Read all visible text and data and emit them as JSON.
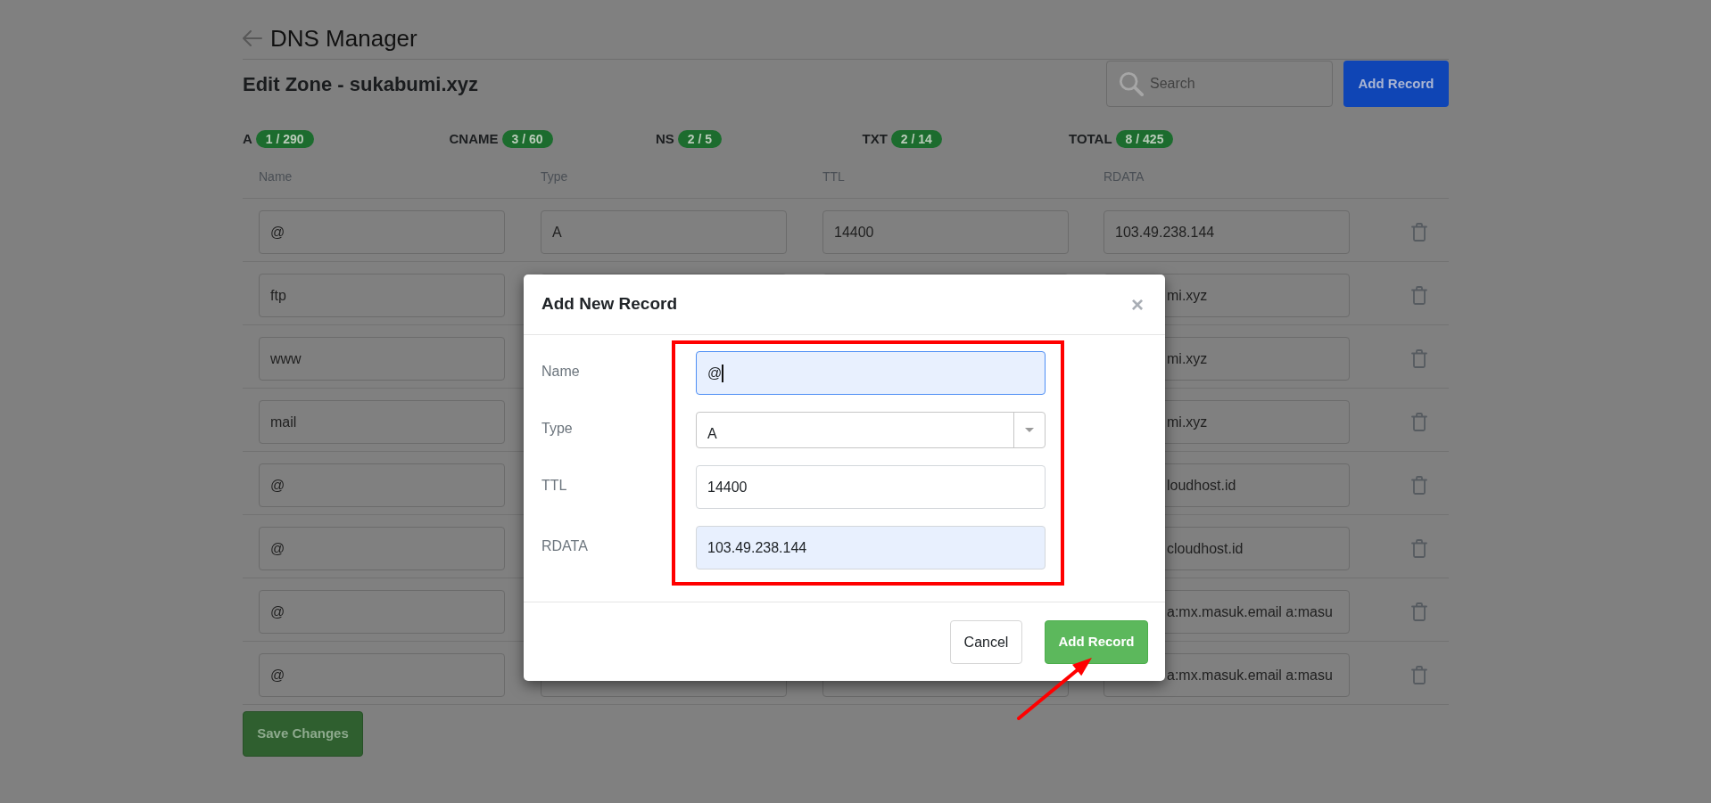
{
  "header": {
    "title": "DNS Manager"
  },
  "zone": {
    "title": "Edit Zone - sukabumi.xyz",
    "search": {
      "placeholder": "Search"
    },
    "add_button": "Add Record"
  },
  "stats": [
    {
      "label": "A",
      "count": "1 / 290"
    },
    {
      "label": "CNAME",
      "count": "3 / 60"
    },
    {
      "label": "NS",
      "count": "2 / 5"
    },
    {
      "label": "TXT",
      "count": "2 / 14"
    },
    {
      "label": "TOTAL",
      "count": "8 / 425"
    }
  ],
  "table": {
    "columns": [
      "Name",
      "Type",
      "TTL",
      "RDATA"
    ],
    "rows": [
      {
        "name": "@",
        "type": "A",
        "ttl": "14400",
        "rdata": "103.49.238.144",
        "rdata_clipped": false
      },
      {
        "name": "ftp",
        "rdata": "mi.xyz",
        "rdata_clipped": true
      },
      {
        "name": "www",
        "rdata": "mi.xyz",
        "rdata_clipped": true
      },
      {
        "name": "mail",
        "rdata": "mi.xyz",
        "rdata_clipped": true
      },
      {
        "name": "@",
        "rdata": "loudhost.id",
        "rdata_clipped": true
      },
      {
        "name": "@",
        "rdata": "cloudhost.id",
        "rdata_clipped": true
      },
      {
        "name": "@",
        "rdata": "a:mx.masuk.email a:masu",
        "rdata_clipped": true
      },
      {
        "name": "@",
        "rdata": "a:mx.masuk.email a:masu",
        "rdata_clipped": true
      }
    ]
  },
  "save_button": "Save Changes",
  "dialog": {
    "title": "Add New Record",
    "close": "×",
    "fields": [
      {
        "label": "Name",
        "kind": "text",
        "value": "@",
        "focused": true,
        "autofilled": true
      },
      {
        "label": "Type",
        "kind": "select",
        "value": "A",
        "focused": false,
        "autofilled": false
      },
      {
        "label": "TTL",
        "kind": "text",
        "value": "14400",
        "focused": false,
        "autofilled": false
      },
      {
        "label": "RDATA",
        "kind": "text",
        "value": "103.49.238.144",
        "focused": false,
        "autofilled": true
      }
    ],
    "buttons": [
      {
        "label": "Cancel",
        "kind": "secondary"
      },
      {
        "label": "Add Record",
        "kind": "primary"
      }
    ]
  }
}
